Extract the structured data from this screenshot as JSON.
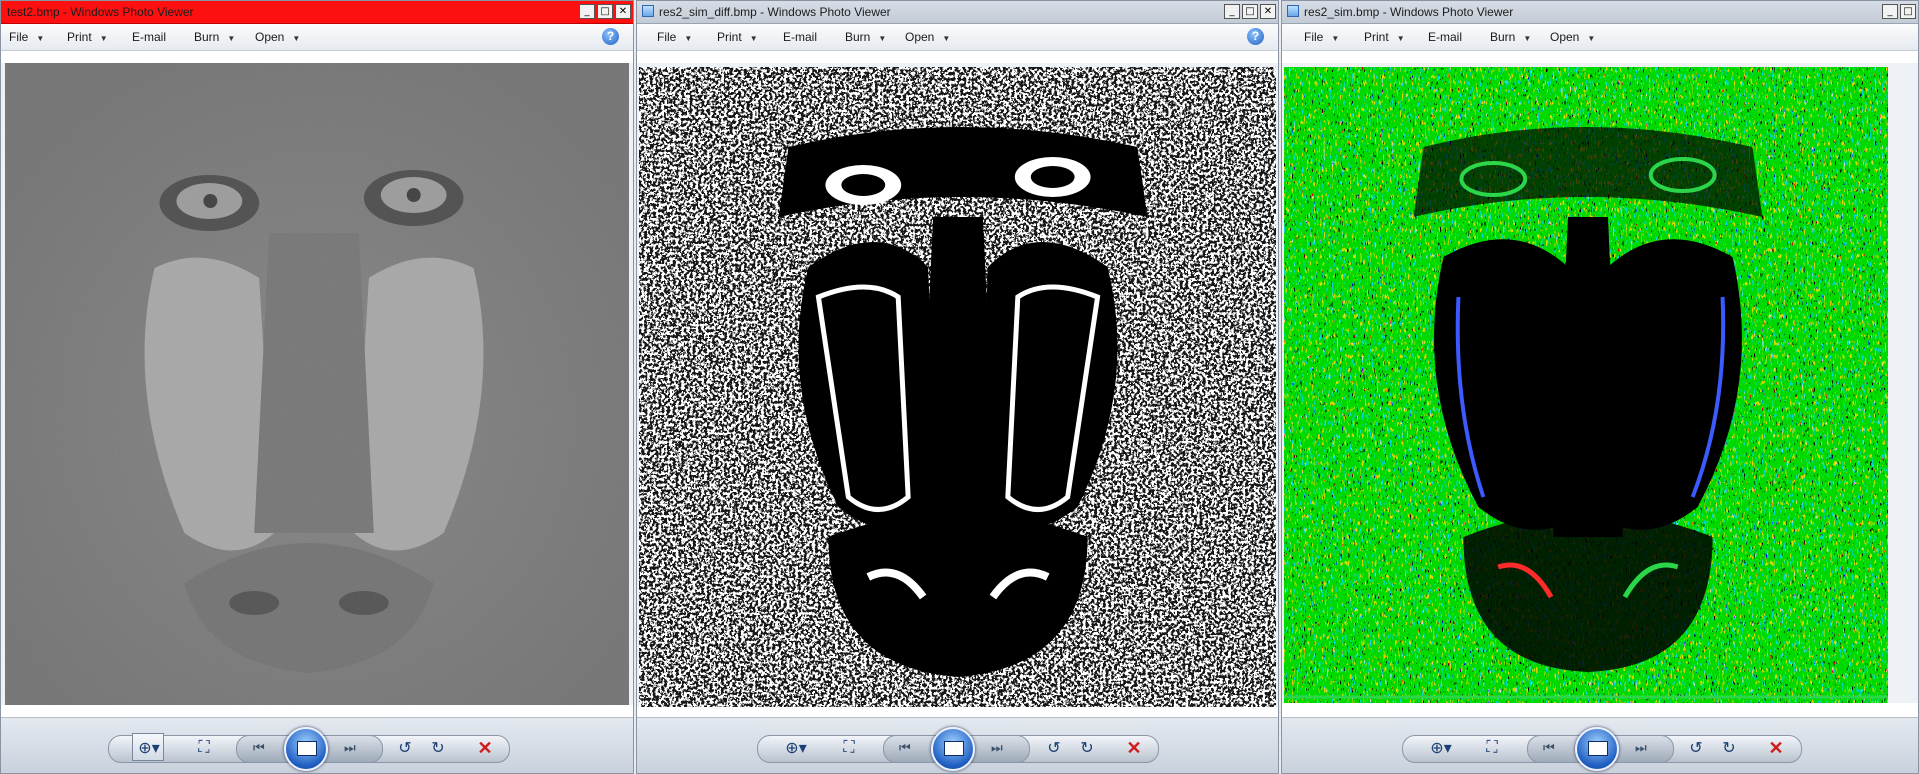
{
  "windows": [
    {
      "title": "test2.bmp - Windows Photo Viewer",
      "active": true,
      "image_kind": "grayscale"
    },
    {
      "title": "res2_sim_diff.bmp - Windows Photo Viewer",
      "active": false,
      "image_kind": "binary"
    },
    {
      "title": "res2_sim.bmp - Windows Photo Viewer",
      "active": false,
      "image_kind": "color"
    }
  ],
  "menu": {
    "file": "File",
    "print": "Print",
    "email": "E-mail",
    "burn": "Burn",
    "open": "Open"
  },
  "icons": {
    "help": "help-icon",
    "zoom": "magnifier-icon",
    "fit": "fit-to-window-icon",
    "previous": "previous-icon",
    "slideshow": "slideshow-icon",
    "next": "next-icon",
    "rotate_ccw": "rotate-counterclockwise-icon",
    "rotate_cw": "rotate-clockwise-icon",
    "delete": "delete-icon"
  },
  "colors": {
    "active_title": "#ff1010",
    "inactive_title": "#c9d0da",
    "delete": "#d11a1a",
    "accent": "#1f5ec2"
  }
}
